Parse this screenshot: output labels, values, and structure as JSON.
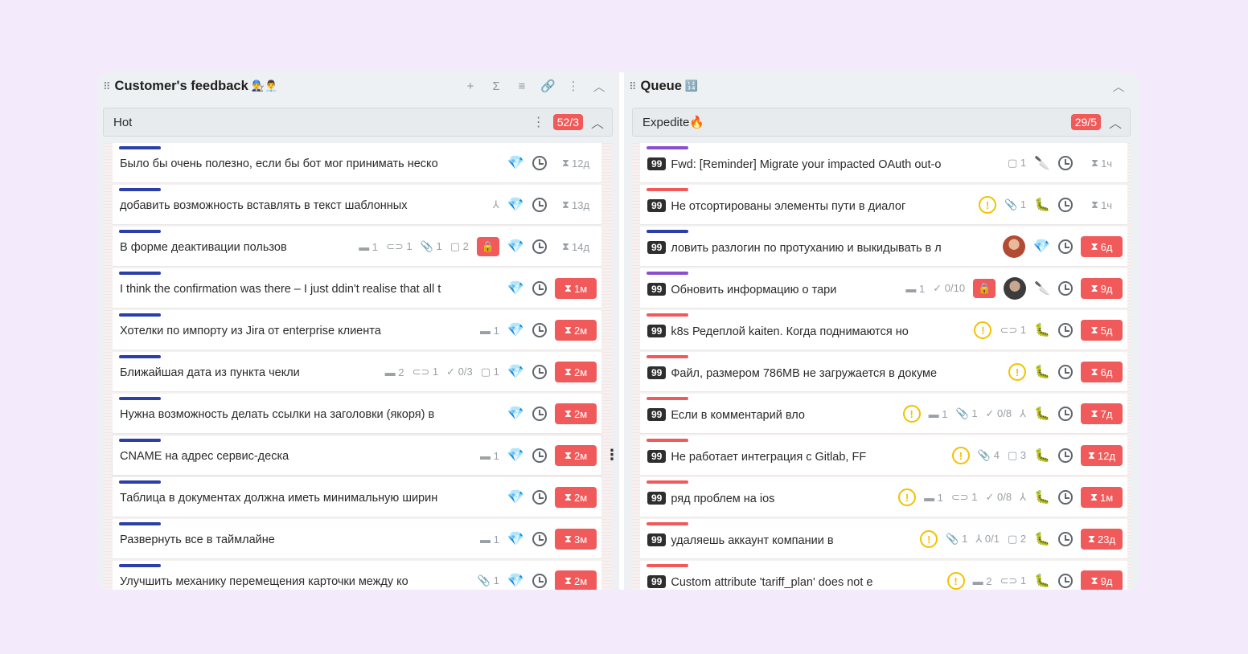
{
  "colors": {
    "accent_red": "#f05a5a",
    "gem": "#1fb0ef",
    "bar_blue": "#2b3fa8",
    "bar_red": "#f05a5a",
    "bar_purple": "#8a4fd0"
  },
  "left": {
    "title": "Customer's feedback",
    "title_emoji": "👨‍🔧👨‍💼",
    "header_icons": [
      {
        "name": "add-icon",
        "glyph": "+"
      },
      {
        "name": "sum-icon",
        "glyph": "Σ"
      },
      {
        "name": "list-icon",
        "glyph": "≡"
      },
      {
        "name": "link-icon",
        "glyph": "🔗"
      },
      {
        "name": "more-icon",
        "glyph": "⋮"
      },
      {
        "name": "collapse-icon",
        "glyph": "︿"
      }
    ],
    "lane": {
      "title": "Hot",
      "wip": "52/3",
      "more": "⋮",
      "collapse": "︿"
    },
    "cards": [
      {
        "title": "Было бы очень полезно, если бы бот мог принимать неско",
        "bar": "#2b3fa8",
        "meta": [
          {
            "t": "gem",
            "v": "💎"
          },
          {
            "t": "clock"
          }
        ],
        "age": "12д",
        "age_red": false
      },
      {
        "title": "добавить возможность вставлять в текст шаблонных",
        "bar": "#2b3fa8",
        "meta": [
          {
            "t": "tree",
            "v": "⅄"
          },
          {
            "t": "gem",
            "v": "💎"
          },
          {
            "t": "clock"
          }
        ],
        "age": "13д",
        "age_red": false
      },
      {
        "title": "В форме деактивации пользов",
        "bar": "#2b3fa8",
        "meta": [
          {
            "t": "tag",
            "v": "▬ 1"
          },
          {
            "t": "link",
            "v": "⊂⊃ 1"
          },
          {
            "t": "clip",
            "v": "📎 1"
          },
          {
            "t": "comment",
            "v": "▢ 2"
          },
          {
            "t": "lock",
            "v": "🔒"
          },
          {
            "t": "gem",
            "v": "💎"
          },
          {
            "t": "clock"
          }
        ],
        "age": "14д",
        "age_red": false
      },
      {
        "title": "I think the confirmation was there – I just ddin't realise that all t",
        "bar": "#2b3fa8",
        "meta": [
          {
            "t": "gem",
            "v": "💎"
          },
          {
            "t": "clock"
          }
        ],
        "age": "1м",
        "age_red": true
      },
      {
        "title": "Хотелки по импорту из Jira от enterprise клиента",
        "bar": "#2b3fa8",
        "meta": [
          {
            "t": "tag",
            "v": "▬ 1"
          },
          {
            "t": "gem",
            "v": "💎"
          },
          {
            "t": "clock"
          }
        ],
        "age": "2м",
        "age_red": true
      },
      {
        "title": "Ближайшая дата из пункта чекли",
        "bar": "#2b3fa8",
        "meta": [
          {
            "t": "tag",
            "v": "▬ 2"
          },
          {
            "t": "link",
            "v": "⊂⊃ 1"
          },
          {
            "t": "check",
            "v": "✓ 0/3"
          },
          {
            "t": "comment",
            "v": "▢ 1"
          },
          {
            "t": "gem",
            "v": "💎"
          },
          {
            "t": "clock"
          }
        ],
        "age": "2м",
        "age_red": true
      },
      {
        "title": "Нужна возможность делать ссылки на заголовки (якоря) в",
        "bar": "#2b3fa8",
        "meta": [
          {
            "t": "gem",
            "v": "💎"
          },
          {
            "t": "clock"
          }
        ],
        "age": "2м",
        "age_red": true
      },
      {
        "title": "CNAME на адрес сервис-деска",
        "bar": "#2b3fa8",
        "meta": [
          {
            "t": "tag",
            "v": "▬ 1"
          },
          {
            "t": "gem",
            "v": "💎"
          },
          {
            "t": "clock"
          }
        ],
        "age": "2м",
        "age_red": true,
        "hover": true
      },
      {
        "title": "Таблица в документах должна иметь минимальную ширин",
        "bar": "#2b3fa8",
        "meta": [
          {
            "t": "gem",
            "v": "💎"
          },
          {
            "t": "clock"
          }
        ],
        "age": "2м",
        "age_red": true
      },
      {
        "title": "Развернуть все в таймлайне",
        "bar": "#2b3fa8",
        "meta": [
          {
            "t": "tag",
            "v": "▬ 1"
          },
          {
            "t": "gem",
            "v": "💎"
          },
          {
            "t": "clock"
          }
        ],
        "age": "3м",
        "age_red": true
      },
      {
        "title": "Улучшить механику перемещения карточки между ко",
        "bar": "#2b3fa8",
        "meta": [
          {
            "t": "clip",
            "v": "📎 1"
          },
          {
            "t": "gem",
            "v": "💎"
          },
          {
            "t": "clock"
          }
        ],
        "age": "2м",
        "age_red": true
      }
    ]
  },
  "right": {
    "title": "Queue",
    "title_emoji": "🔢",
    "collapse": "︿",
    "lane": {
      "title": "Expedite🔥",
      "wip": "29/5",
      "collapse": "︿"
    },
    "badge": "99",
    "cards": [
      {
        "title": "Fwd: [Reminder] Migrate your impacted OAuth out-o",
        "bar": "#8a4fd0",
        "meta": [
          {
            "t": "comment",
            "v": "▢ 1"
          },
          {
            "t": "emo",
            "v": "🔪"
          },
          {
            "t": "clock"
          }
        ],
        "age": "1ч",
        "age_red": false
      },
      {
        "title": "Не отсортированы элементы пути в диалог",
        "bar": "#f05a5a",
        "meta": [
          {
            "t": "warn",
            "v": "!"
          },
          {
            "t": "clip",
            "v": "📎 1"
          },
          {
            "t": "emo",
            "v": "🐛"
          },
          {
            "t": "clock"
          }
        ],
        "age": "1ч",
        "age_red": false
      },
      {
        "title": "ловить разлогин по протуханию и выкидывать в л",
        "bar": "#2b3fa8",
        "meta": [
          {
            "t": "avatar1"
          },
          {
            "t": "gem",
            "v": "💎"
          },
          {
            "t": "clock"
          }
        ],
        "age": "6д",
        "age_red": true
      },
      {
        "title": "Обновить информацию о тари",
        "bar": "#8a4fd0",
        "meta": [
          {
            "t": "tag",
            "v": "▬ 1"
          },
          {
            "t": "check",
            "v": "✓ 0/10"
          },
          {
            "t": "lock",
            "v": "🔒"
          },
          {
            "t": "avatar2"
          },
          {
            "t": "emo",
            "v": "🔪"
          },
          {
            "t": "clock"
          }
        ],
        "age": "9д",
        "age_red": true
      },
      {
        "title": "k8s Редеплой kaiten. Когда поднимаются но",
        "bar": "#f05a5a",
        "meta": [
          {
            "t": "warn",
            "v": "!"
          },
          {
            "t": "link",
            "v": "⊂⊃ 1"
          },
          {
            "t": "emo",
            "v": "🐛"
          },
          {
            "t": "clock"
          }
        ],
        "age": "5д",
        "age_red": true
      },
      {
        "title": "Файл, размером 786MB не загружается в докуме",
        "bar": "#f05a5a",
        "meta": [
          {
            "t": "warn",
            "v": "!"
          },
          {
            "t": "emo",
            "v": "🐛"
          },
          {
            "t": "clock"
          }
        ],
        "age": "6д",
        "age_red": true
      },
      {
        "title": "Если в комментарий вло",
        "bar": "#f05a5a",
        "meta": [
          {
            "t": "warn",
            "v": "!"
          },
          {
            "t": "tag",
            "v": "▬ 1"
          },
          {
            "t": "clip",
            "v": "📎 1"
          },
          {
            "t": "check",
            "v": "✓ 0/8"
          },
          {
            "t": "tree",
            "v": "⅄"
          },
          {
            "t": "emo",
            "v": "🐛"
          },
          {
            "t": "clock"
          }
        ],
        "age": "7д",
        "age_red": true
      },
      {
        "title": "Не работает интеграция с Gitlab, FF",
        "bar": "#f05a5a",
        "meta": [
          {
            "t": "warn",
            "v": "!"
          },
          {
            "t": "clip",
            "v": "📎 4"
          },
          {
            "t": "comment",
            "v": "▢ 3"
          },
          {
            "t": "emo",
            "v": "🐛"
          },
          {
            "t": "clock"
          }
        ],
        "age": "12д",
        "age_red": true
      },
      {
        "title": "ряд проблем на ios",
        "bar": "#f05a5a",
        "meta": [
          {
            "t": "warn",
            "v": "!"
          },
          {
            "t": "tag",
            "v": "▬ 1"
          },
          {
            "t": "link",
            "v": "⊂⊃ 1"
          },
          {
            "t": "check",
            "v": "✓ 0/8"
          },
          {
            "t": "tree",
            "v": "⅄"
          },
          {
            "t": "emo",
            "v": "🐛"
          },
          {
            "t": "clock"
          }
        ],
        "age": "1м",
        "age_red": true
      },
      {
        "title": "удаляешь аккаунт компании в",
        "bar": "#f05a5a",
        "meta": [
          {
            "t": "warn",
            "v": "!"
          },
          {
            "t": "clip",
            "v": "📎 1"
          },
          {
            "t": "tree",
            "v": "⅄ 0/1"
          },
          {
            "t": "comment",
            "v": "▢ 2"
          },
          {
            "t": "emo",
            "v": "🐛"
          },
          {
            "t": "clock"
          }
        ],
        "age": "23д",
        "age_red": true
      },
      {
        "title": "Custom attribute 'tariff_plan' does not e",
        "bar": "#f05a5a",
        "meta": [
          {
            "t": "warn",
            "v": "!"
          },
          {
            "t": "tag",
            "v": "▬ 2"
          },
          {
            "t": "link",
            "v": "⊂⊃ 1"
          },
          {
            "t": "emo",
            "v": "🐛"
          },
          {
            "t": "clock"
          }
        ],
        "age": "9д",
        "age_red": true
      }
    ]
  }
}
